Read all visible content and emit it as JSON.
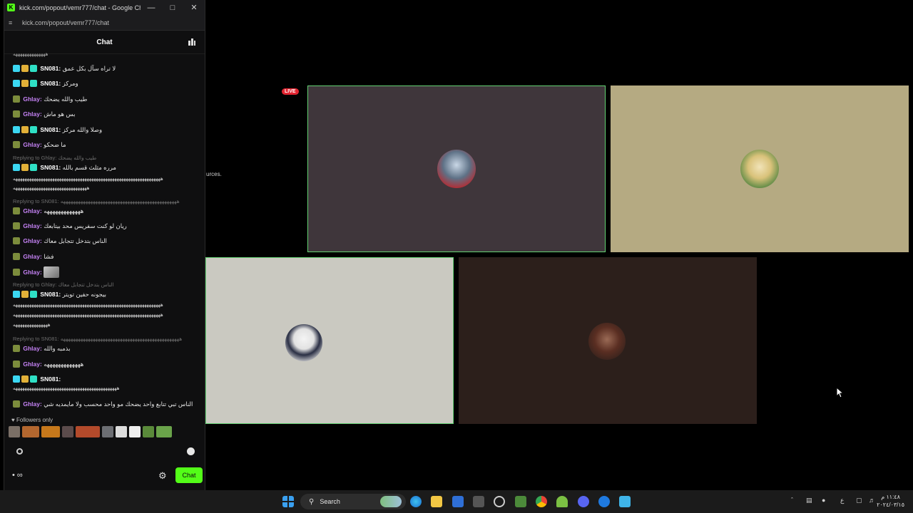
{
  "window": {
    "title": "kick.com/popout/vemr777/chat - Google Chro...",
    "url": "kick.com/popout/vemr777/chat",
    "favicon": "K"
  },
  "chat": {
    "header": "Chat",
    "messages": [
      {
        "user": "SN081:",
        "text": "لا تراه سآل بكل عمق",
        "badges": "full"
      },
      {
        "user": "SN081:",
        "text": "ومركز",
        "badges": "full"
      },
      {
        "user": "Ghlay:",
        "text": "طيب والله يضحك",
        "badges": "sub"
      },
      {
        "user": "Ghlay:",
        "text": "بس هو ماش",
        "badges": "sub"
      },
      {
        "user": "SN081:",
        "text": "وصلا والله مركز",
        "badges": "full"
      },
      {
        "user": "Ghlay:",
        "text": "ما ضحكو",
        "badges": "sub"
      }
    ],
    "top_fragment": "ههههههههههههههه",
    "reply1": "Replying to Ghlay: طيب والله يضحك",
    "msg7_user": "SN081:",
    "msg7_text": "مرره مثلث قسم بالله",
    "msg7_cont1": "ههههههههههههههههههههههههههههههههههههههههههههههههههههههههههههههههه",
    "msg7_cont2": "ههههههههههههههههههههههههههههههههه",
    "reply2": "Replying to SN081: هههههههههههههههههههههههههههههههههههههههههههههههه",
    "msg8_user": "Ghlay:",
    "msg8_text": "هههههههههههههه",
    "msg9_user": "Ghlay:",
    "msg9_text": "ريان لو كنت سفريس محد بيتابعك",
    "msg10_user": "Ghlay:",
    "msg10_text": "الناس بتدخل تتجابل معاك",
    "msg11_user": "Ghlay:",
    "msg11_text": "فشا",
    "msg12_user": "Ghlay:",
    "reply3": "Replying to Ghlay: الناس بتدخل تتجابل معاك",
    "msg13_user": "SN081:",
    "msg13_text": "بيجونه حفين تويتر",
    "msg13_cont1": "ههههههههههههههههههههههههههههههههههههههههههههههههههههههههههههههههه",
    "msg13_cont2": "ههههههههههههههههههههههههههههههههههههههههههههههههههههههههههههههههه",
    "msg13_cont3": "هههههههههههههههه",
    "reply4": "Replying to SN081: ههههههههههههههههههههههههههههههههههههههههههههههههه",
    "msg14_user": "Ghlay:",
    "msg14_text": "بذمبه والله",
    "msg15_user": "Ghlay:",
    "msg15_text": "هههههههههههههه",
    "msg16_user": "SN081:",
    "msg16_cont": "هههههههههههههههههههههههههههههههههههههههههههههه",
    "msg17_user": "Ghlay:",
    "msg17_text": "الناس تبي تتابع واحد يضحك مو واحد محسب ولا مايمديه شي",
    "followers_only": "Followers only",
    "send_label": "Chat",
    "points_label": "∞"
  },
  "stream": {
    "live_label": "LIVE",
    "side_text": "urces."
  },
  "taskbar": {
    "search_label": "Search",
    "clock_time": "١١:٤٨ م",
    "clock_date": "٢٠٢٤/٠٣/١٥",
    "lang": "ع"
  },
  "colors": {
    "kick_green": "#53fc18",
    "username_purple": "#c582f5",
    "active_border": "#63d173",
    "live_red": "#e22531"
  }
}
